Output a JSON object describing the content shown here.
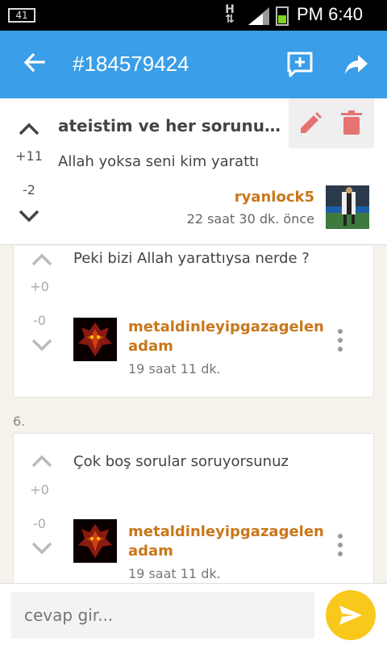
{
  "status_bar": {
    "battery_left": "41",
    "network": "H",
    "time": "PM 6:40"
  },
  "app_bar": {
    "title": "#184579424"
  },
  "topic": {
    "title": "ateistim ve her sorunuz...",
    "up_count": "+11",
    "down_count": "-2",
    "text": "Allah yoksa seni kim yarattı",
    "author": "ryanlock5",
    "date": "22 saat 30 dk. önce"
  },
  "entries": [
    {
      "text": "Peki bizi Allah yarattıysa nerde ?",
      "plus": "+0",
      "minus": "-0",
      "author_line1": "metaldinleyipgazagelen",
      "author_line2": "adam",
      "date": "19 saat 11 dk."
    },
    {
      "number": "6.",
      "text": "Çok boş sorular soruyorsunuz",
      "plus": "+0",
      "minus": "-0",
      "author_line1": "metaldinleyipgazagelen",
      "author_line2": "adam",
      "date": "19 saat 11 dk."
    }
  ],
  "reply": {
    "placeholder": "cevap gir..."
  },
  "colors": {
    "app_bar": "#3a9ee8",
    "author": "#c8771a",
    "send": "#f8c81a"
  }
}
